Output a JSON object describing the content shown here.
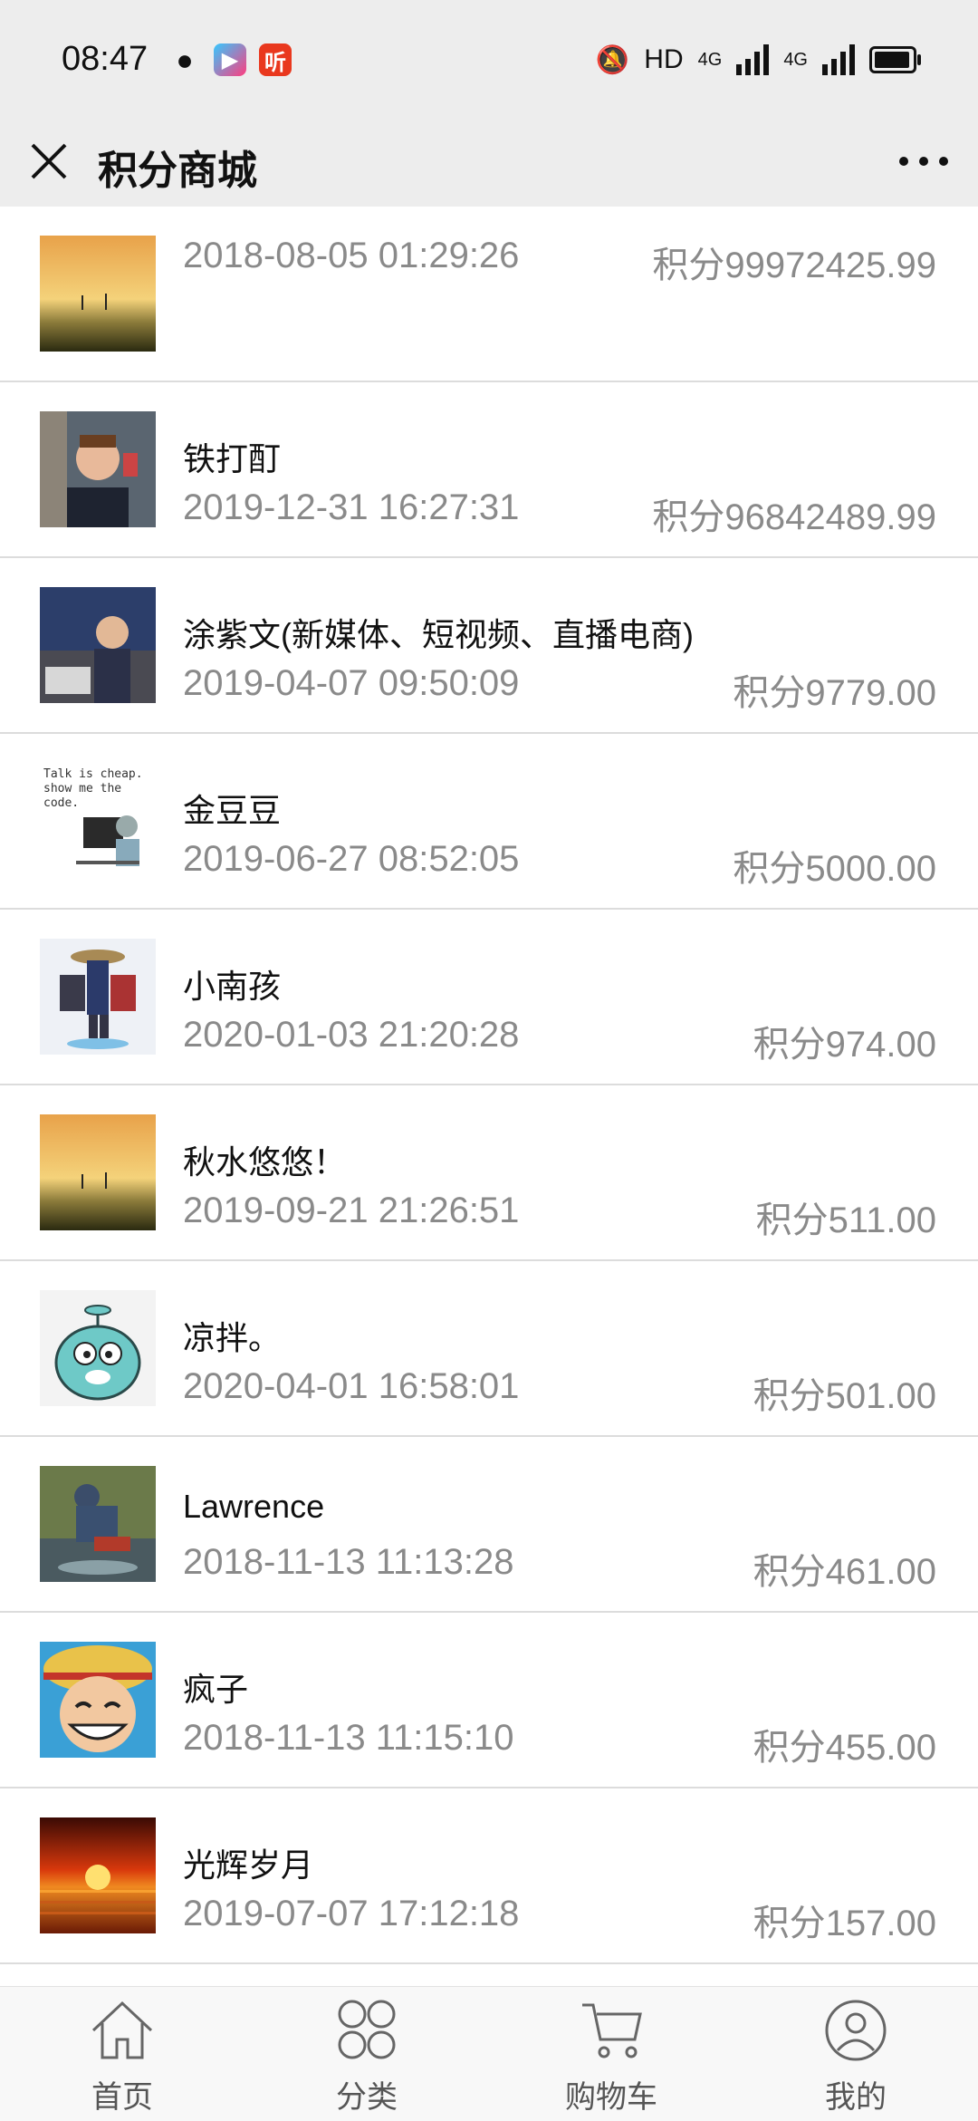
{
  "status_bar": {
    "time": "08:47",
    "app_icons": [
      "wechat-icon",
      "video-app-icon",
      "listen-app-icon"
    ],
    "listen_icon_text": "听",
    "network": "HD",
    "signal1": "4G",
    "signal2": "4G",
    "battery_level": 0.95
  },
  "nav": {
    "title": "积分商城",
    "close_icon": "close-icon",
    "more_icon": "more-icon"
  },
  "list": [
    {
      "name": "",
      "date": "2018-08-05 01:29:26",
      "points": "积分99972425.99",
      "avatar": "sunset-sky"
    },
    {
      "name": "铁打酊",
      "date": "2019-12-31 16:27:31",
      "points": "积分96842489.99",
      "avatar": "boy-photo"
    },
    {
      "name": "涂紫文(新媒体、短视频、直播电商)",
      "date": "2019-04-07 09:50:09",
      "points": "积分9779.00",
      "avatar": "man-laptop"
    },
    {
      "name": "金豆豆",
      "date": "2019-06-27 08:52:05",
      "points": "积分5000.00",
      "avatar": "talk-is-cheap",
      "avatar_text": "Talk is cheap. show me the code."
    },
    {
      "name": "小南孩",
      "date": "2020-01-03 21:20:28",
      "points": "积分974.00",
      "avatar": "traveler-bags"
    },
    {
      "name": "秋水悠悠！",
      "date": "2019-09-21 21:26:51",
      "points": "积分511.00",
      "avatar": "sunset-sky"
    },
    {
      "name": "凉拌。",
      "date": "2020-04-01 16:58:01",
      "points": "积分501.00",
      "avatar": "cartoon-cat"
    },
    {
      "name": "Lawrence",
      "date": "2018-11-13 11:13:28",
      "points": "积分461.00",
      "avatar": "man-river"
    },
    {
      "name": "疯子",
      "date": "2018-11-13 11:15:10",
      "points": "积分455.00",
      "avatar": "anime-luffy"
    },
    {
      "name": "光辉岁月",
      "date": "2019-07-07 17:12:18",
      "points": "积分157.00",
      "avatar": "sea-sunset"
    },
    {
      "name": "",
      "date": "",
      "points": "",
      "avatar": "partial"
    }
  ],
  "tabs": [
    {
      "label": "首页",
      "icon": "home-icon"
    },
    {
      "label": "分类",
      "icon": "category-icon"
    },
    {
      "label": "购物车",
      "icon": "cart-icon"
    },
    {
      "label": "我的",
      "icon": "profile-icon"
    }
  ],
  "colors": {
    "header_bg": "#ededed",
    "secondary_text": "#8a8a8a",
    "primary_text": "#111111",
    "divider": "#dcdcdc"
  }
}
